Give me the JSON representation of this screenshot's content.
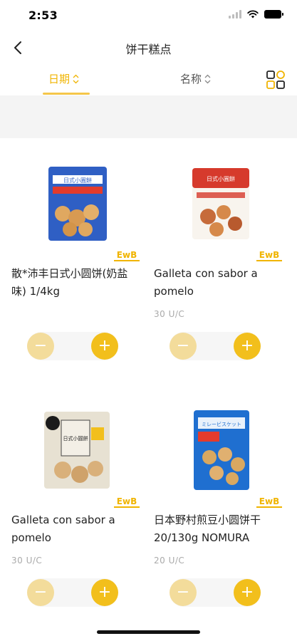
{
  "status": {
    "time": "2:53"
  },
  "nav": {
    "title": "饼干糕点",
    "back_icon": "chevron-left-icon"
  },
  "sort": {
    "date_label": "日期",
    "name_label": "名称",
    "active_color": "#f0b400",
    "grid_icon": "grid-view-icon"
  },
  "products": [
    {
      "name": "散*沛丰日式小圆饼(奶盐味) 1/4kg",
      "unit": "",
      "package_label": "日式小圓餅",
      "package_color": "#2f5fc4",
      "brand": "EwB"
    },
    {
      "name": "Galleta con sabor a pomelo",
      "unit": "30 U/C",
      "package_label": "日式小圓餅",
      "package_color": "#d63a2c",
      "brand": "EwB"
    },
    {
      "name": "Galleta con sabor a pomelo",
      "unit": "30 U/C",
      "package_label": "日式小圓餅",
      "package_color": "#e7e1d2",
      "brand": "EwB"
    },
    {
      "name": "日本野村煎豆小圆饼干 20/130g NOMURA",
      "unit": "20 U/C",
      "package_label": "ミレービスケット",
      "package_color": "#1f6fd0",
      "brand": "EwB"
    }
  ],
  "stepper": {
    "minus": "−",
    "plus": "+"
  }
}
